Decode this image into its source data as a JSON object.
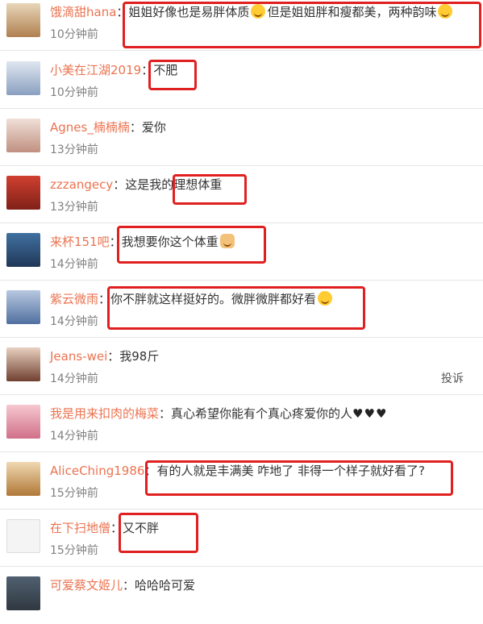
{
  "colors": {
    "username": "#eb7350",
    "highlight": "#e02020",
    "time": "#808080"
  },
  "comments": [
    {
      "user": "饿滴甜hana",
      "text": "姐姐好像也是易胖体质",
      "text2": "但是姐姐胖和瘦都美，两种韵味",
      "time": "10分钟前",
      "emoji": "tongue-face-icon"
    },
    {
      "user": "小美在江湖2019",
      "text": "不肥",
      "time": "10分钟前"
    },
    {
      "user": "Agnes_楠楠楠",
      "text": "爱你",
      "time": "13分钟前"
    },
    {
      "user": "zzzangecy",
      "text_a": "这是我的",
      "text_b": "理想体重",
      "time": "13分钟前"
    },
    {
      "user": "来杯151吧",
      "text": "我想要你这个体重",
      "time": "14分钟前",
      "emoji": "cat-face-icon"
    },
    {
      "user": "紫云微雨",
      "text": "你不胖就这样挺好的。微胖微胖都好看",
      "time": "14分钟前",
      "emoji": "smile-face-icon"
    },
    {
      "user": "Jeans-wei",
      "text": "我98斤",
      "time": "14分钟前",
      "report": "投诉"
    },
    {
      "user": "我是用来扣肉的梅菜",
      "text": "真心希望你能有个真心疼爱你的人",
      "hearts": "♥♥♥",
      "time": "14分钟前"
    },
    {
      "user": "AliceChing1986",
      "text": "有的人就是丰满美 咋地了 非得一个样子就好看了?",
      "time": "15分钟前"
    },
    {
      "user": "在下扫地僧",
      "text": "又不胖",
      "time": "15分钟前"
    },
    {
      "user": "可爱蔡文姬儿",
      "text": "哈哈哈可爱",
      "time": ""
    }
  ]
}
